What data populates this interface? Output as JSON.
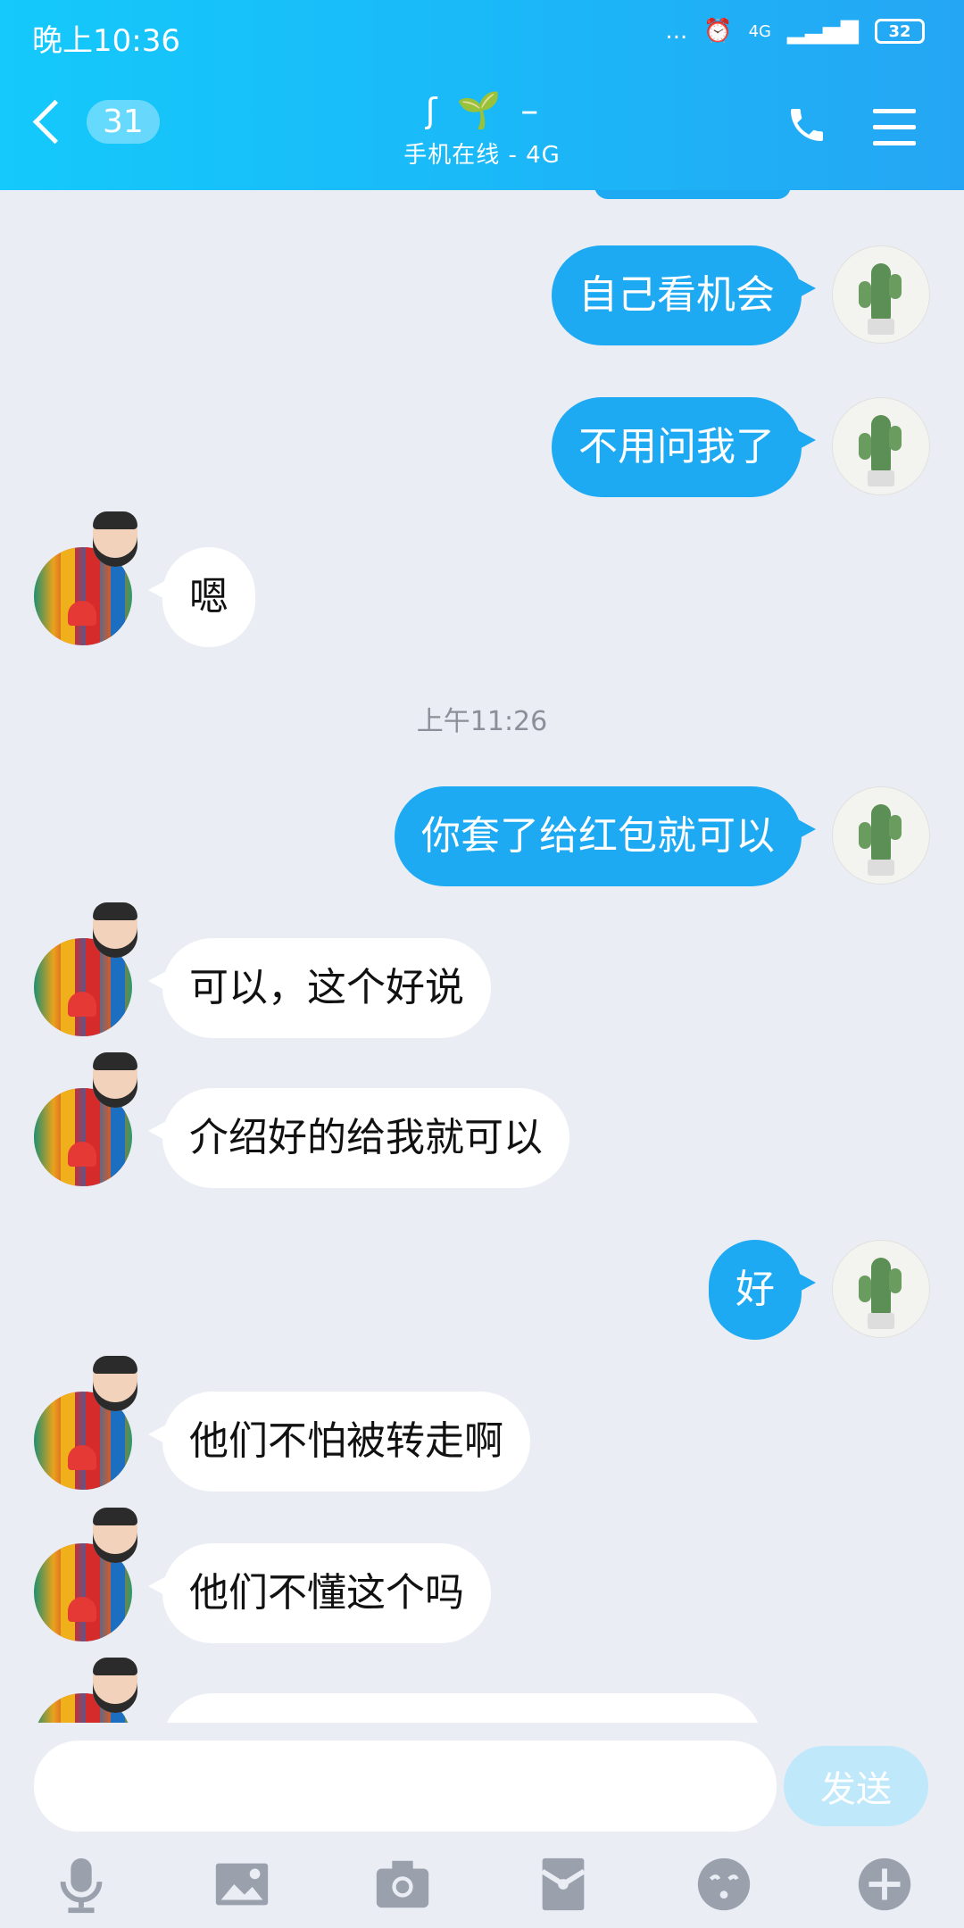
{
  "status_bar": {
    "time": "晚上10:36",
    "dots": "...",
    "network": "4G",
    "battery": "32"
  },
  "header": {
    "back_count": "31",
    "contact_name": "–",
    "subtitle": "手机在线 - 4G"
  },
  "messages": [
    {
      "side": "me",
      "text": "自己看机会"
    },
    {
      "side": "me",
      "text": "不用问我了"
    },
    {
      "side": "them",
      "text": "嗯"
    },
    {
      "side": "timestamp",
      "text": "上午11:26"
    },
    {
      "side": "me",
      "text": "你套了给红包就可以"
    },
    {
      "side": "them",
      "text": "可以，这个好说"
    },
    {
      "side": "them",
      "text": "介绍好的给我就可以"
    },
    {
      "side": "me",
      "text": "好"
    },
    {
      "side": "them",
      "text": "他们不怕被转走啊"
    },
    {
      "side": "them",
      "text": "他们不懂这个吗"
    }
  ],
  "input": {
    "placeholder": "",
    "send_label": "发送"
  },
  "toolbar": [
    "mic-icon",
    "image-icon",
    "camera-icon",
    "red-packet-icon",
    "emoji-icon",
    "plus-icon"
  ],
  "colors": {
    "accent": "#1ea9f3",
    "header_start": "#14c9fb",
    "background": "#eaedf4",
    "send_disabled": "#bfe8fb"
  }
}
